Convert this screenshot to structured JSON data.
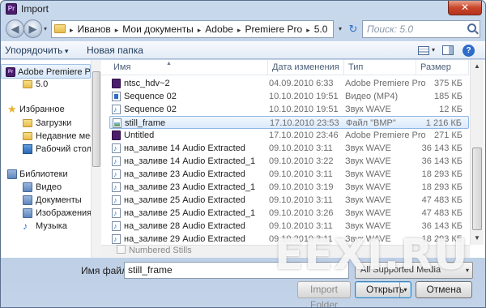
{
  "window": {
    "title": "Import",
    "close_glyph": "✕"
  },
  "nav": {
    "back_glyph": "◀",
    "forward_glyph": "▶",
    "history_glyph": "▾",
    "breadcrumb": [
      "Иванов",
      "Мои документы",
      "Adobe",
      "Premiere Pro",
      "5.0"
    ],
    "breadcrumb_separator": "▸",
    "refresh_glyph": "↻",
    "search_placeholder": "Поиск: 5.0"
  },
  "toolbar": {
    "organize_label": "Упорядочить",
    "new_folder_label": "Новая папка",
    "help_glyph": "?"
  },
  "sidebar": {
    "items": [
      {
        "label": "Adobe Premiere Pr",
        "icon": "premiere-icon",
        "selected": true
      },
      {
        "label": "5.0",
        "icon": "folder-icon"
      },
      {
        "label": "Избранное",
        "icon": "star-icon"
      },
      {
        "label": "Загрузки",
        "icon": "folder-icon"
      },
      {
        "label": "Недавние места",
        "icon": "folder-icon"
      },
      {
        "label": "Рабочий стол",
        "icon": "desktop-icon"
      },
      {
        "label": "Библиотеки",
        "icon": "library-icon"
      },
      {
        "label": "Видео",
        "icon": "library-icon"
      },
      {
        "label": "Документы",
        "icon": "library-icon"
      },
      {
        "label": "Изображения",
        "icon": "library-icon"
      },
      {
        "label": "Музыка",
        "icon": "music-icon"
      }
    ],
    "glyphs": {
      "premiere": "Pr",
      "star": "★",
      "music": "♪"
    }
  },
  "columns": {
    "name": "Имя",
    "date": "Дата изменения",
    "type": "Тип",
    "size": "Размер",
    "sort_glyph": "▲"
  },
  "files": [
    {
      "name": "ntsc_hdv~2",
      "date": "04.09.2010 6:33",
      "type": "Adobe Premiere Pro",
      "size": "375 КБ",
      "kind": "prproj"
    },
    {
      "name": "Sequence 02",
      "date": "10.10.2010 19:51",
      "type": "Видео (MP4)",
      "size": "185 КБ",
      "kind": "video"
    },
    {
      "name": "Sequence 02",
      "date": "10.10.2010 19:51",
      "type": "Звук WAVE",
      "size": "12 КБ",
      "kind": "audio"
    },
    {
      "name": "still_frame",
      "date": "17.10.2010 23:53",
      "type": "Файл \"BMP\"",
      "size": "1 216 КБ",
      "kind": "bmp",
      "selected": true
    },
    {
      "name": "Untitled",
      "date": "17.10.2010 23:46",
      "type": "Adobe Premiere Pro",
      "size": "271 КБ",
      "kind": "prproj"
    },
    {
      "name": "на_заливе 14 Audio Extracted",
      "date": "09.10.2010 3:11",
      "type": "Звук WAVE",
      "size": "36 143 КБ",
      "kind": "audio"
    },
    {
      "name": "на_заливе 14 Audio Extracted_1",
      "date": "09.10.2010 3:22",
      "type": "Звук WAVE",
      "size": "36 143 КБ",
      "kind": "audio"
    },
    {
      "name": "на_заливе 23 Audio Extracted",
      "date": "09.10.2010 3:11",
      "type": "Звук WAVE",
      "size": "18 293 КБ",
      "kind": "audio"
    },
    {
      "name": "на_заливе 23 Audio Extracted_1",
      "date": "09.10.2010 3:19",
      "type": "Звук WAVE",
      "size": "18 293 КБ",
      "kind": "audio"
    },
    {
      "name": "на_заливе 25 Audio Extracted",
      "date": "09.10.2010 3:11",
      "type": "Звук WAVE",
      "size": "47 483 КБ",
      "kind": "audio"
    },
    {
      "name": "на_заливе 25 Audio Extracted_1",
      "date": "09.10.2010 3:26",
      "type": "Звук WAVE",
      "size": "47 483 КБ",
      "kind": "audio"
    },
    {
      "name": "на_заливе 28 Audio Extracted",
      "date": "09.10.2010 3:11",
      "type": "Звук WAVE",
      "size": "36 143 КБ",
      "kind": "audio"
    },
    {
      "name": "на_заливе 29 Audio Extracted",
      "date": "09.10.2010 3:11",
      "type": "Звук WAVE",
      "size": "18 293 КБ",
      "kind": "audio"
    }
  ],
  "numbered_stills": {
    "label": "Numbered Stills",
    "checked": false
  },
  "filename": {
    "label": "Имя файла:",
    "value": "still_frame"
  },
  "filter": {
    "selected": "All Supported Media",
    "arrow_glyph": "▾"
  },
  "buttons": {
    "import_folder": "Import Folder",
    "open": "Открыть",
    "open_split_glyph": "▾",
    "cancel": "Отмена"
  },
  "scroll_glyphs": {
    "up": "▲",
    "down": "▼"
  },
  "watermark": "EEXI.RU",
  "colors": {
    "selection": "#dbeafb",
    "accent": "#2d6cc9",
    "premiere": "#4b1d6b"
  }
}
